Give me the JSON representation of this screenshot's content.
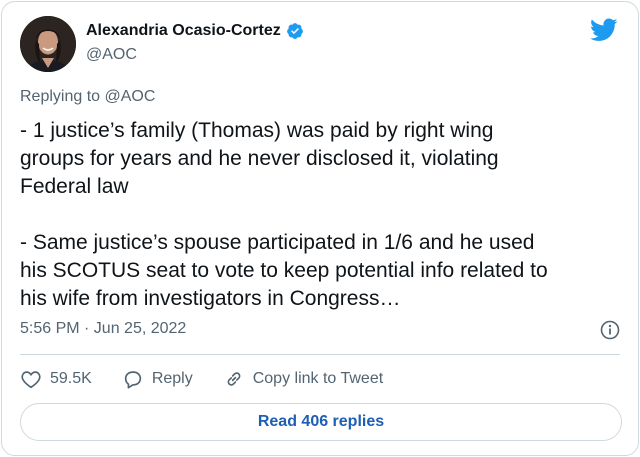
{
  "author": {
    "name": "Alexandria Ocasio-Cortez",
    "handle": "@AOC",
    "verified_icon": "verified-badge-icon",
    "avatar_alt": "profile photo"
  },
  "brand_icon": "twitter-bird-icon",
  "reply_context": "Replying to @AOC",
  "tweet_lines": [
    "- 1 justice’s family (Thomas) was paid by right wing",
    "groups for years and he never disclosed it, violating",
    "Federal law",
    "",
    "- Same justice’s spouse participated in 1/6 and he used",
    "his SCOTUS seat to vote to keep potential info related to",
    "his wife from investigators in Congress…"
  ],
  "timestamp": "5:56 PM · Jun 25, 2022",
  "info_icon": "info-icon",
  "actions": {
    "like_count": "59.5K",
    "reply_label": "Reply",
    "copy_label": "Copy link to Tweet"
  },
  "read_replies_label": "Read 406 replies",
  "colors": {
    "accent": "#1d9bf0",
    "link": "#1d5fb4",
    "muted": "#536471",
    "text": "#0f1419",
    "border": "#cfd9de"
  }
}
